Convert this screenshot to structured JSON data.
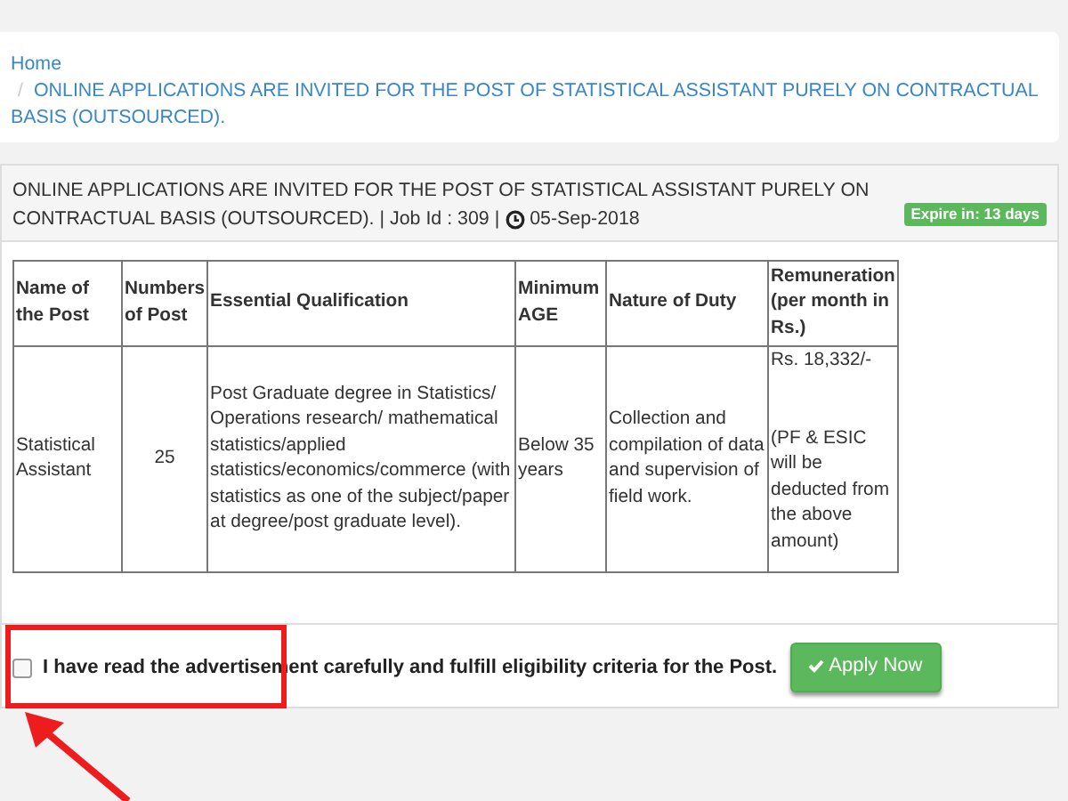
{
  "breadcrumb": [
    {
      "label": "Home"
    },
    {
      "separator": "/",
      "label": "ONLINE APPLICATIONS ARE INVITED FOR THE POST OF STATISTICAL ASSISTANT PURELY ON CONTRACTUAL BASIS (OUTSOURCED)."
    }
  ],
  "job": {
    "title": "ONLINE APPLICATIONS ARE INVITED FOR THE POST OF STATISTICAL ASSISTANT PURELY ON CONTRACTUAL BASIS (OUTSOURCED). | Job Id : 309 |",
    "date": "05-Sep-2018",
    "badge": "Expire in: 13 days"
  },
  "table": {
    "columns": [
      "Name of the Post",
      "Numbers of Post",
      "Essential Qualification",
      "Minimum AGE",
      "Nature of Duty",
      "Remuneration (per month in Rs.)"
    ],
    "rows": [
      [
        "Statistical Assistant",
        "25",
        "Post Graduate degree in Statistics/ Operations research/ mathematical statistics/applied statistics/economics/commerce (with statistics as one of the subject/paper at degree/post graduate level).",
        "Below 35 years",
        "Collection and compilation of data and supervision of field work.",
        "Rs. 18,332/-\n\n\n(PF & ESIC will be deducted from the above amount)"
      ]
    ]
  },
  "agreement": {
    "label": "I have read the advertisement carefully and fulfill eligibility criteria for the Post.",
    "checked": false
  },
  "apply_button": {
    "label": "Apply Now"
  }
}
